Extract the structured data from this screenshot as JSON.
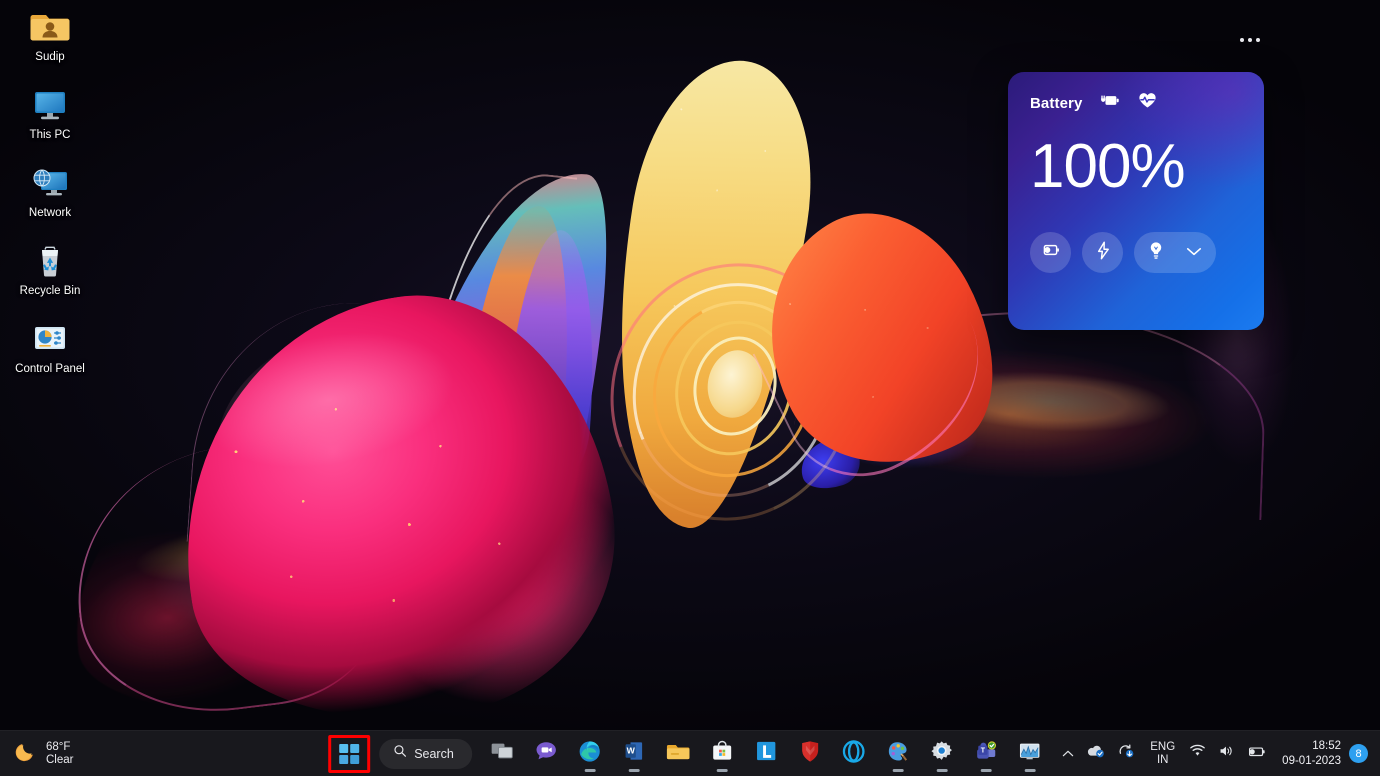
{
  "desktop": {
    "icons": [
      {
        "label": "Sudip",
        "icon": "user-folder-icon"
      },
      {
        "label": "This PC",
        "icon": "this-pc-icon"
      },
      {
        "label": "Network",
        "icon": "network-icon"
      },
      {
        "label": "Recycle Bin",
        "icon": "recycle-bin-icon"
      },
      {
        "label": "Control Panel",
        "icon": "control-panel-icon"
      }
    ],
    "wallpaper_name": "Windows 11 Bloom abstract flower"
  },
  "battery_widget": {
    "title": "Battery",
    "percent": "100%",
    "header_icons": [
      "battery-plug-icon",
      "heart-pulse-icon"
    ],
    "actions": [
      {
        "name": "battery-saver-button",
        "icon": "battery-saver-icon"
      },
      {
        "name": "charge-boost-button",
        "icon": "lightning-bolt-icon"
      },
      {
        "name": "brightness-button",
        "icon": "lightbulb-icon"
      },
      {
        "name": "expand-button",
        "icon": "chevron-down-icon"
      }
    ],
    "more_menu": "...",
    "colors": {
      "gradient_start": "#2b1b7a",
      "gradient_end": "#1b7bf0",
      "text": "#ffffff"
    }
  },
  "taskbar": {
    "weather": {
      "temperature": "68°F",
      "condition": "Clear",
      "icon": "crescent-moon-icon"
    },
    "start": {
      "label": "Start",
      "icon": "windows-logo-icon",
      "highlight_color": "#ff0000",
      "highlighted": true
    },
    "search": {
      "label": "Search",
      "icon": "search-icon"
    },
    "apps": [
      {
        "name": "task-view",
        "label": "Task View",
        "running": false
      },
      {
        "name": "chat",
        "label": "Chat",
        "running": false
      },
      {
        "name": "microsoft-edge",
        "label": "Microsoft Edge",
        "running": true
      },
      {
        "name": "microsoft-word",
        "label": "Microsoft Word",
        "running": true
      },
      {
        "name": "file-explorer",
        "label": "File Explorer",
        "running": false
      },
      {
        "name": "microsoft-store",
        "label": "Microsoft Store",
        "running": true
      },
      {
        "name": "linkedin",
        "label": "L",
        "running": false
      },
      {
        "name": "mcafee",
        "label": "McAfee",
        "running": false
      },
      {
        "name": "opera",
        "label": "Opera",
        "running": false
      },
      {
        "name": "paint",
        "label": "Paint",
        "running": true
      },
      {
        "name": "settings",
        "label": "Settings",
        "running": true
      },
      {
        "name": "microsoft-teams",
        "label": "Microsoft Teams",
        "running": true
      },
      {
        "name": "task-manager",
        "label": "Task Manager",
        "running": true
      }
    ],
    "tray": {
      "overflow_icon": "chevron-up-icon",
      "items": [
        "onedrive-icon",
        "sync-update-icon"
      ],
      "language": {
        "primary": "ENG",
        "secondary": "IN"
      },
      "status_icons": [
        "wifi-icon",
        "speaker-icon",
        "battery-icon"
      ],
      "clock": {
        "time": "18:52",
        "date": "09-01-2023"
      },
      "notifications": {
        "count": "8",
        "color": "#2ea0f0"
      }
    }
  }
}
